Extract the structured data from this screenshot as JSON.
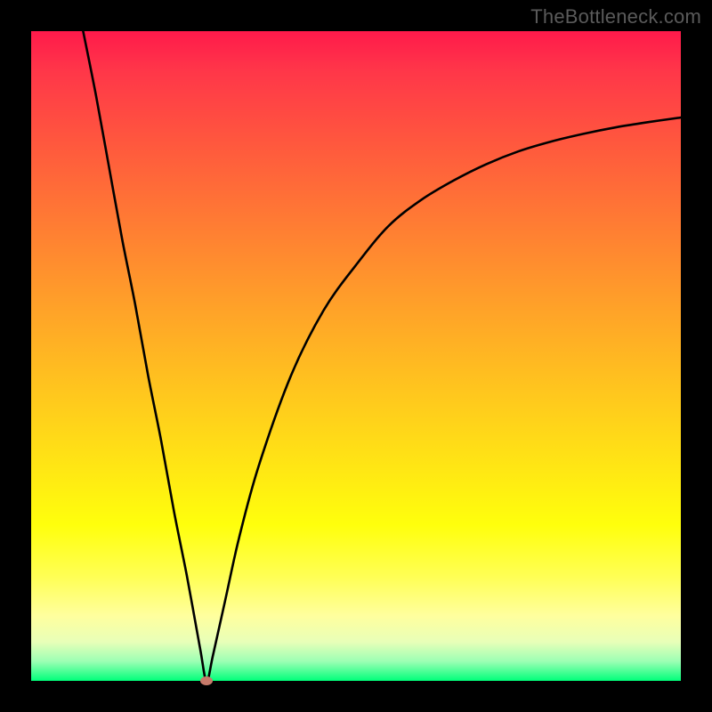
{
  "watermark": "TheBottleneck.com",
  "colors": {
    "frame": "#000000",
    "gradient_top": "#ff1a4b",
    "gradient_bottom": "#00ff7a",
    "curve_stroke": "#000000",
    "marker": "#c77a6a"
  },
  "chart_data": {
    "type": "line",
    "title": "",
    "xlabel": "",
    "ylabel": "",
    "xlim": [
      0,
      100
    ],
    "ylim": [
      0,
      100
    ],
    "grid": false,
    "legend": false,
    "marker": {
      "x": 27,
      "y": 0
    },
    "series": [
      {
        "name": "bottleneck-curve",
        "x": [
          8,
          10,
          12,
          14,
          16,
          18,
          20,
          22,
          24,
          26,
          27,
          28,
          30,
          32,
          35,
          40,
          45,
          50,
          55,
          60,
          65,
          70,
          75,
          80,
          85,
          90,
          95,
          100
        ],
        "y": [
          100,
          90,
          79,
          68,
          58,
          47,
          37,
          26,
          16,
          5,
          0,
          4,
          13,
          22,
          33,
          47,
          57,
          64,
          70,
          74,
          77,
          79.5,
          81.5,
          83,
          84.2,
          85.2,
          86,
          86.7
        ]
      }
    ]
  }
}
